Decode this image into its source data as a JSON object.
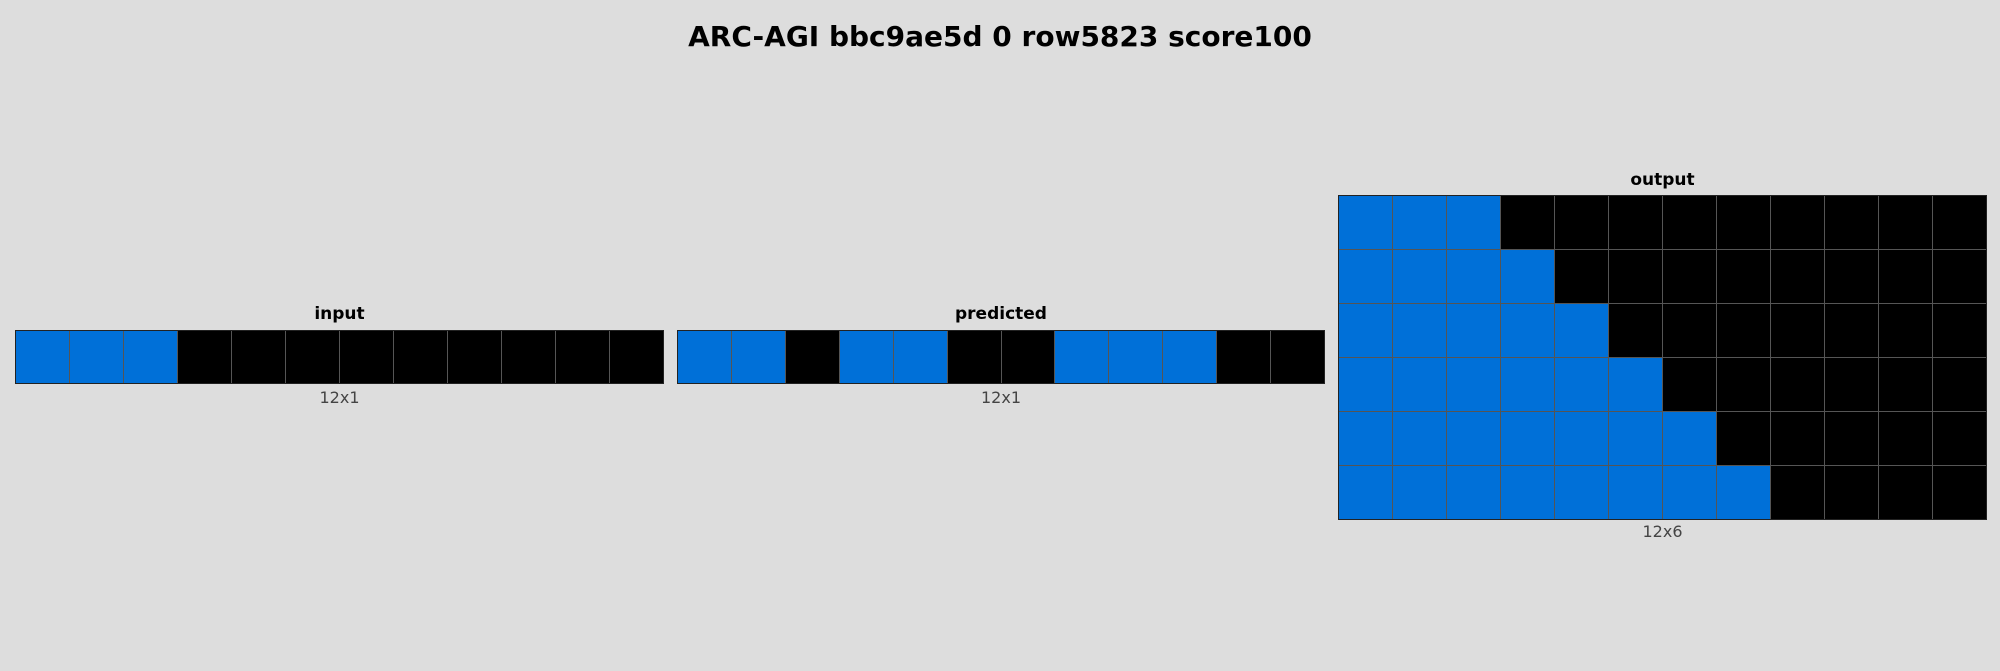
{
  "title": "ARC-AGI bbc9ae5d 0 row5823 score100",
  "colors": {
    "0": "#000000",
    "1": "#0070d8",
    "background": "#dddddd"
  },
  "panels": {
    "input": {
      "label": "input",
      "dims": "12x1",
      "grid": [
        [
          1,
          1,
          1,
          0,
          0,
          0,
          0,
          0,
          0,
          0,
          0,
          0
        ]
      ]
    },
    "predicted": {
      "label": "predicted",
      "dims": "12x1",
      "grid": [
        [
          1,
          1,
          0,
          1,
          1,
          0,
          0,
          1,
          1,
          1,
          0,
          0
        ]
      ]
    },
    "output": {
      "label": "output",
      "dims": "12x6",
      "grid": [
        [
          1,
          1,
          1,
          0,
          0,
          0,
          0,
          0,
          0,
          0,
          0,
          0
        ],
        [
          1,
          1,
          1,
          1,
          0,
          0,
          0,
          0,
          0,
          0,
          0,
          0
        ],
        [
          1,
          1,
          1,
          1,
          1,
          0,
          0,
          0,
          0,
          0,
          0,
          0
        ],
        [
          1,
          1,
          1,
          1,
          1,
          1,
          0,
          0,
          0,
          0,
          0,
          0
        ],
        [
          1,
          1,
          1,
          1,
          1,
          1,
          1,
          0,
          0,
          0,
          0,
          0
        ],
        [
          1,
          1,
          1,
          1,
          1,
          1,
          1,
          1,
          0,
          0,
          0,
          0
        ]
      ]
    }
  }
}
